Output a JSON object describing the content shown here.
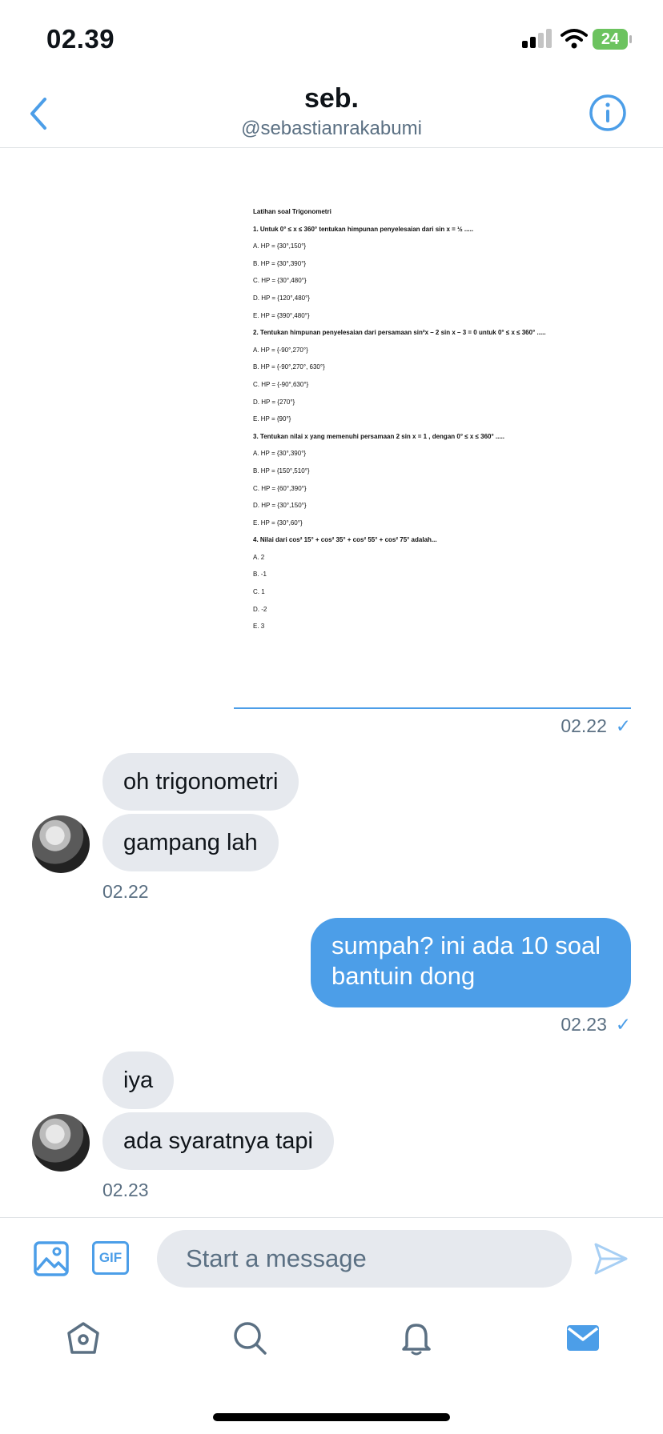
{
  "status_bar": {
    "time": "02.39",
    "battery": "24"
  },
  "header": {
    "name": "seb.",
    "handle": "@sebastianrakabumi"
  },
  "attachment": {
    "document_lines": [
      {
        "text": "Latihan soal Trigonometri",
        "bold": true
      },
      {
        "text": "1. Untuk 0° ≤ x ≤ 360° tentukan himpunan penyelesaian dari sin x = ½ .....",
        "bold": true
      },
      {
        "text": "A. HP = {30°,150°}",
        "bold": false
      },
      {
        "text": "B. HP = {30°,390°}",
        "bold": false
      },
      {
        "text": "C. HP = {30°,480°}",
        "bold": false
      },
      {
        "text": "D. HP = {120°,480°}",
        "bold": false
      },
      {
        "text": "E. HP = {390°,480°}",
        "bold": false
      },
      {
        "text": "2. Tentukan himpunan penyelesaian dari persamaan sin²x – 2 sin x – 3 = 0 untuk 0° ≤ x ≤ 360° .....",
        "bold": true
      },
      {
        "text": "A. HP = {-90°,270°}",
        "bold": false
      },
      {
        "text": "B. HP = {-90°,270°, 630°}",
        "bold": false
      },
      {
        "text": "C. HP = {-90°,630°}",
        "bold": false
      },
      {
        "text": "D. HP = {270°}",
        "bold": false
      },
      {
        "text": "E. HP = {90°}",
        "bold": false
      },
      {
        "text": "3. Tentukan nilai x yang memenuhi persamaan 2 sin x = 1 , dengan 0° ≤ x ≤ 360° .....",
        "bold": true
      },
      {
        "text": "A. HP = {30°,390°}",
        "bold": false
      },
      {
        "text": "B. HP = {150°,510°}",
        "bold": false
      },
      {
        "text": "C. HP = {60°,390°}",
        "bold": false
      },
      {
        "text": "D. HP = {30°,150°}",
        "bold": false
      },
      {
        "text": "E. HP = {30°,60°}",
        "bold": false
      },
      {
        "text": "4. Nilai dari cos² 15° + cos² 35° + cos² 55° + cos² 75° adalah...",
        "bold": true
      },
      {
        "text": "A. 2",
        "bold": false
      },
      {
        "text": "B. -1",
        "bold": false
      },
      {
        "text": "C. 1",
        "bold": false
      },
      {
        "text": "D. -2",
        "bold": false
      },
      {
        "text": "E. 3",
        "bold": false
      }
    ],
    "time": "02.22"
  },
  "messages": {
    "in1": {
      "line1": "oh trigonometri",
      "line2": "gampang lah",
      "time": "02.22"
    },
    "out1": {
      "line1": "sumpah? ini ada 10 soal",
      "line2": "bantuin dong",
      "time": "02.23"
    },
    "in2": {
      "line1": "iya",
      "line2": "ada syaratnya tapi",
      "time": "02.23"
    }
  },
  "composer": {
    "placeholder": "Start a message",
    "gif_label": "GIF"
  },
  "colors": {
    "accent": "#4c9ee8",
    "bubble_in": "#e6e9ee",
    "muted": "#5b7083",
    "battery": "#6cc35f"
  },
  "icons": [
    "back-chevron-icon",
    "info-icon",
    "image-icon",
    "gif-icon",
    "send-icon",
    "home-icon",
    "search-icon",
    "bell-icon",
    "mail-icon"
  ]
}
